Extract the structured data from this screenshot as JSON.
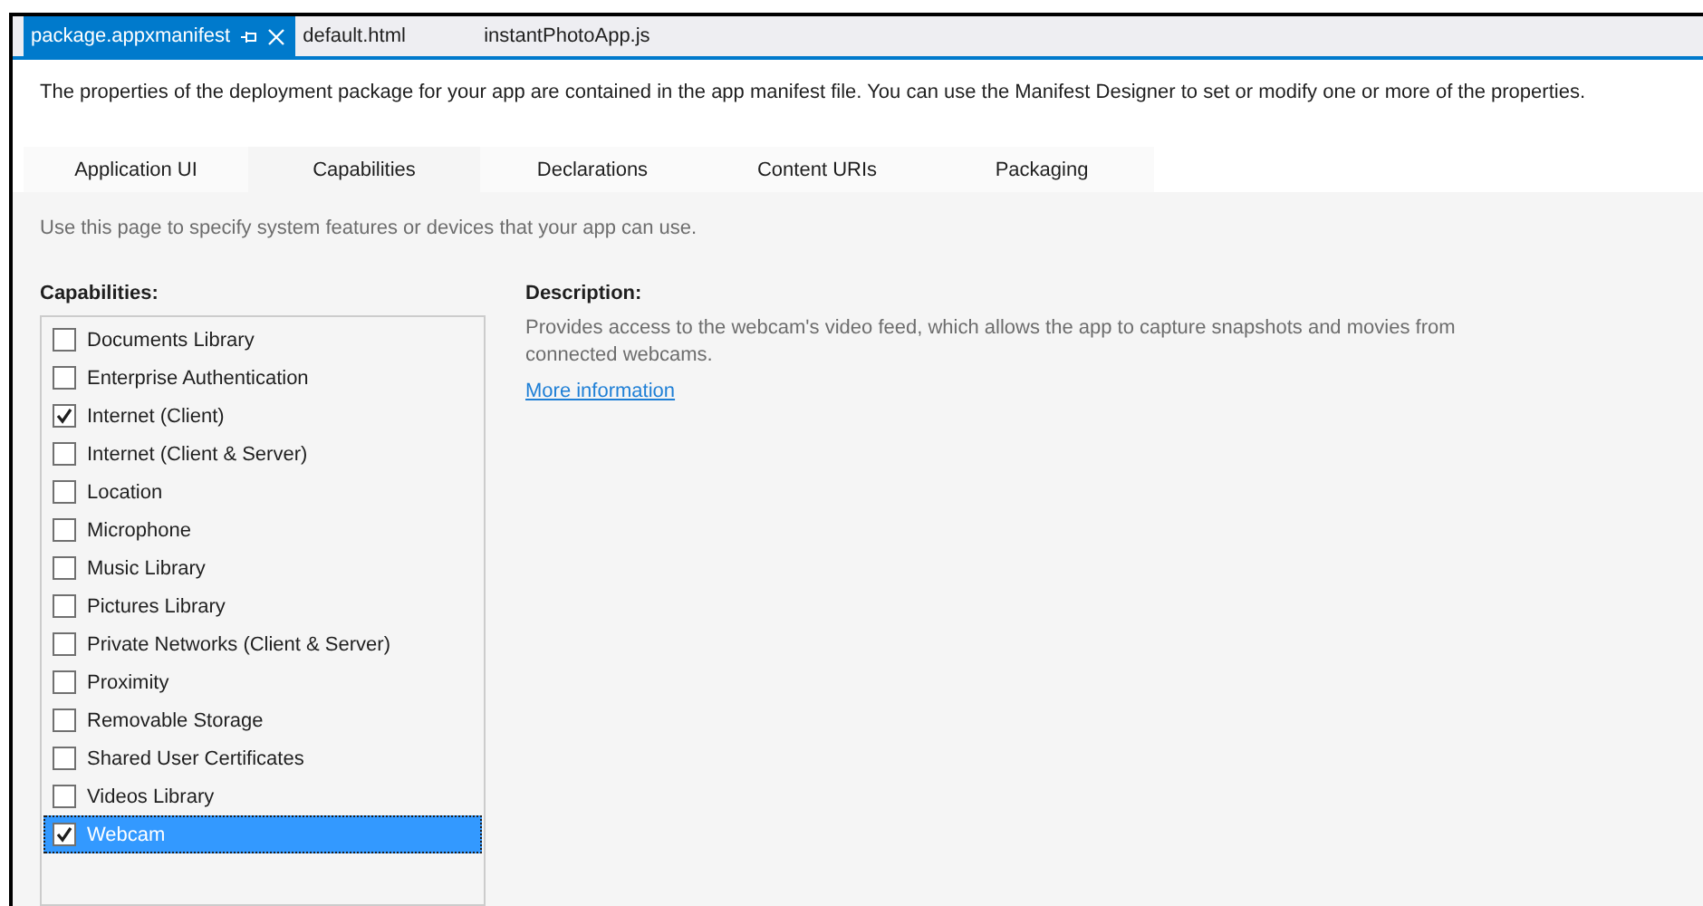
{
  "doc_tabs": [
    {
      "label": "package.appxmanifest",
      "selected": true
    },
    {
      "label": "default.html",
      "selected": false
    },
    {
      "label": "instantPhotoApp.js",
      "selected": false
    }
  ],
  "intro": "The properties of the deployment package for your app are contained in the app manifest file. You can use the Manifest Designer to set or modify one or more of the properties.",
  "tabs": [
    {
      "label": "Application UI",
      "selected": false
    },
    {
      "label": "Capabilities",
      "selected": true
    },
    {
      "label": "Declarations",
      "selected": false
    },
    {
      "label": "Content URIs",
      "selected": false
    },
    {
      "label": "Packaging",
      "selected": false
    }
  ],
  "page_hint": "Use this page to specify system features or devices that your app can use.",
  "capabilities": {
    "heading": "Capabilities:",
    "items": [
      {
        "label": "Documents Library",
        "checked": false,
        "selected": false
      },
      {
        "label": "Enterprise Authentication",
        "checked": false,
        "selected": false
      },
      {
        "label": "Internet (Client)",
        "checked": true,
        "selected": false
      },
      {
        "label": "Internet (Client & Server)",
        "checked": false,
        "selected": false
      },
      {
        "label": "Location",
        "checked": false,
        "selected": false
      },
      {
        "label": "Microphone",
        "checked": false,
        "selected": false
      },
      {
        "label": "Music Library",
        "checked": false,
        "selected": false
      },
      {
        "label": "Pictures Library",
        "checked": false,
        "selected": false
      },
      {
        "label": "Private Networks (Client & Server)",
        "checked": false,
        "selected": false
      },
      {
        "label": "Proximity",
        "checked": false,
        "selected": false
      },
      {
        "label": "Removable Storage",
        "checked": false,
        "selected": false
      },
      {
        "label": "Shared User Certificates",
        "checked": false,
        "selected": false
      },
      {
        "label": "Videos Library",
        "checked": false,
        "selected": false
      },
      {
        "label": "Webcam",
        "checked": true,
        "selected": true
      }
    ]
  },
  "description": {
    "heading": "Description:",
    "text": "Provides access to the webcam's video feed, which allows the app to capture snapshots and movies from connected webcams.",
    "link": "More information"
  }
}
